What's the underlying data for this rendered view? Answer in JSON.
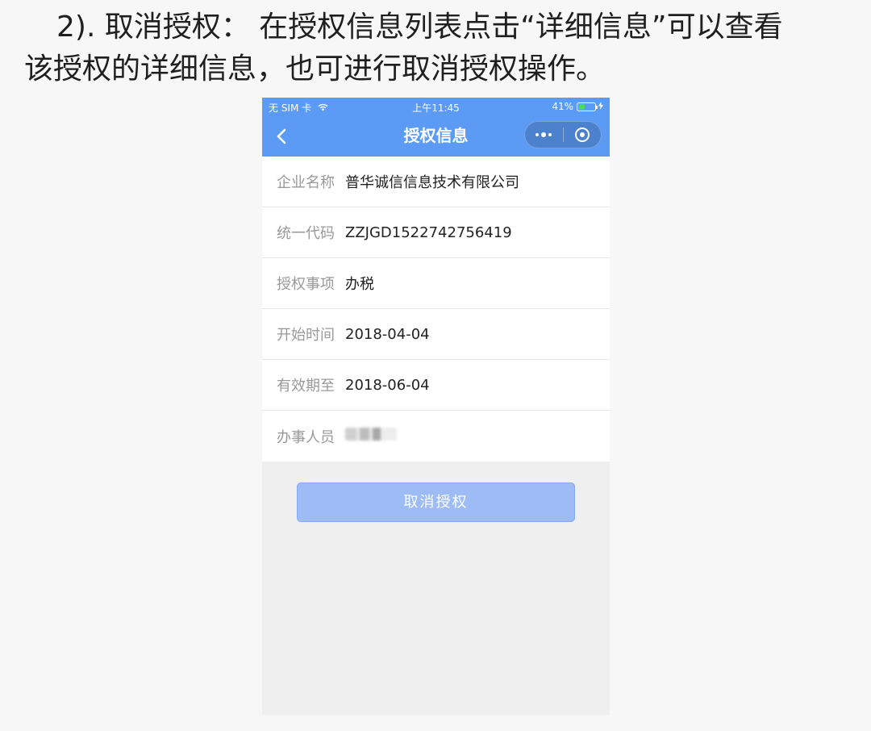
{
  "instruction": {
    "line1": "2). 取消授权： 在授权信息列表点击“详细信息”可以查看",
    "line2": "该授权的详细信息，也可进行取消授权操作。"
  },
  "status_bar": {
    "carrier": "无 SIM 卡",
    "wifi_icon": "wifi-icon",
    "time": "上午11:45",
    "battery_percent": "41%",
    "battery_level": 0.41,
    "charging_icon": "bolt-icon"
  },
  "nav": {
    "back_icon": "chevron-left-icon",
    "title": "授权信息",
    "more_icon": "more-dots-icon",
    "close_icon": "target-circle-icon"
  },
  "info": {
    "rows": [
      {
        "label": "企业名称",
        "value": "普华诚信信息技术有限公司"
      },
      {
        "label": "统一代码",
        "value": "ZZJGD1522742756419"
      },
      {
        "label": "授权事项",
        "value": "办税"
      },
      {
        "label": "开始时间",
        "value": "2018-04-04"
      },
      {
        "label": "有效期至",
        "value": "2018-06-04"
      },
      {
        "label": "办事人员",
        "value": ""
      }
    ]
  },
  "actions": {
    "cancel_label": "取消授权"
  },
  "colors": {
    "nav_bg": "#5b9bf5",
    "button_bg": "#9dbcf5",
    "page_bg": "#efefef",
    "battery_fill": "#4cd964"
  }
}
